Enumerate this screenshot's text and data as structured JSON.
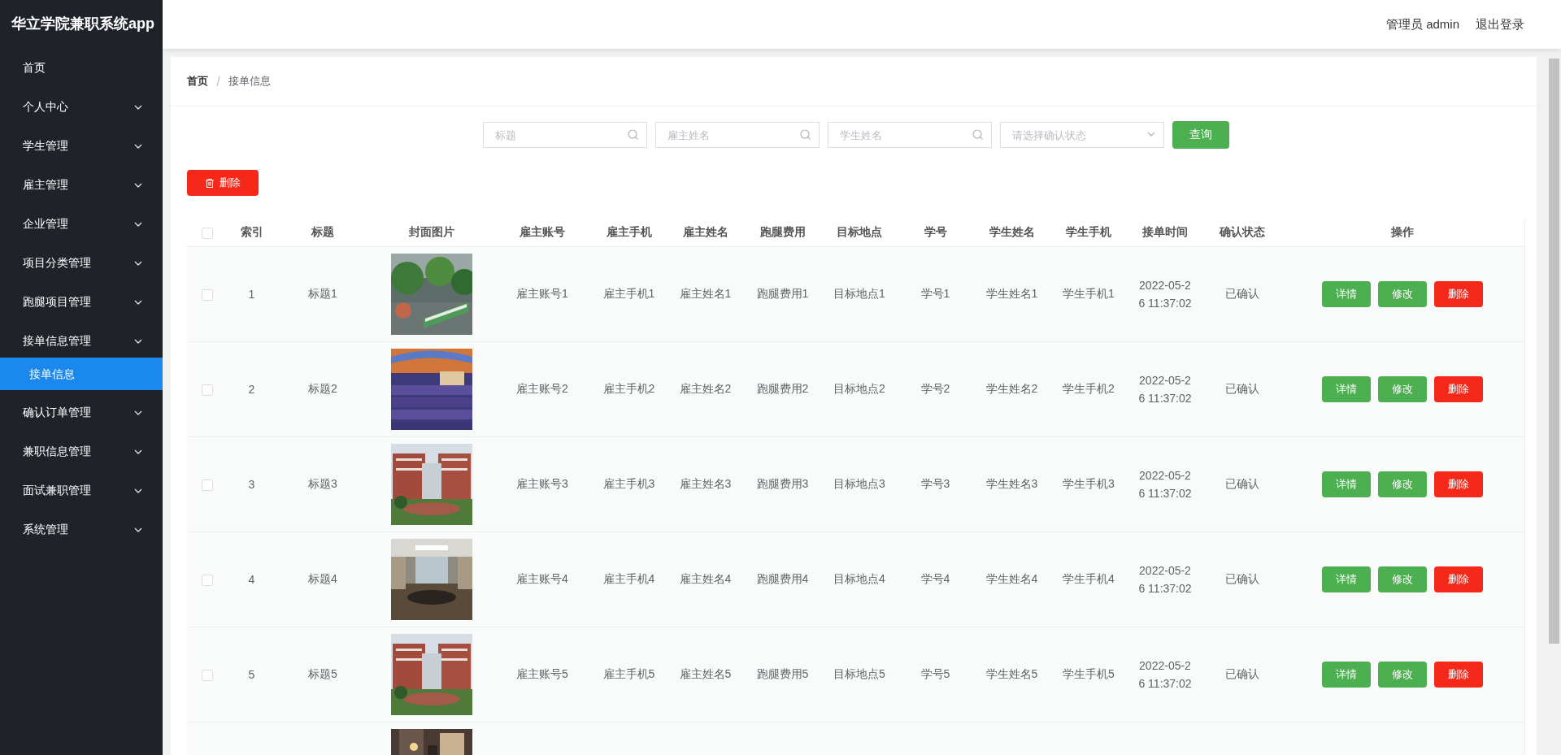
{
  "sidebar": {
    "title": "华立学院兼职系统app",
    "items": [
      {
        "label": "首页",
        "kind": "link"
      },
      {
        "label": "个人中心",
        "kind": "submenu"
      },
      {
        "label": "学生管理",
        "kind": "submenu"
      },
      {
        "label": "雇主管理",
        "kind": "submenu"
      },
      {
        "label": "企业管理",
        "kind": "submenu"
      },
      {
        "label": "项目分类管理",
        "kind": "submenu"
      },
      {
        "label": "跑腿项目管理",
        "kind": "submenu"
      },
      {
        "label": "接单信息管理",
        "kind": "submenu",
        "children": [
          {
            "label": "接单信息",
            "selected": true
          }
        ]
      },
      {
        "label": "确认订单管理",
        "kind": "submenu"
      },
      {
        "label": "兼职信息管理",
        "kind": "submenu"
      },
      {
        "label": "面试兼职管理",
        "kind": "submenu"
      },
      {
        "label": "系统管理",
        "kind": "submenu"
      }
    ]
  },
  "header": {
    "user": "管理员 admin",
    "logout": "退出登录"
  },
  "breadcrumb": [
    "首页",
    "接单信息"
  ],
  "search": {
    "fields": [
      {
        "placeholder": "标题",
        "kind": "text"
      },
      {
        "placeholder": "雇主姓名",
        "kind": "text"
      },
      {
        "placeholder": "学生姓名",
        "kind": "text"
      },
      {
        "placeholder": "请选择确认状态",
        "kind": "select"
      }
    ],
    "button": "查询"
  },
  "toolbar": {
    "delete_button": "删除"
  },
  "table": {
    "select_all": {
      "checked": false
    },
    "columns": [
      "索引",
      "标题",
      "封面图片",
      "雇主账号",
      "雇主手机",
      "雇主姓名",
      "跑腿费用",
      "目标地点",
      "学号",
      "学生姓名",
      "学生手机",
      "接单时间",
      "确认状态",
      "操作"
    ],
    "rows": [
      {
        "checked": false,
        "cells": [
          "1",
          "标题1",
          null,
          "雇主账号1",
          "雇主手机1",
          "雇主姓名1",
          "跑腿费用1",
          "目标地点1",
          "学号1",
          "学生姓名1",
          "学生手机1",
          "2022-05-26 11:37:02",
          "已确认"
        ],
        "actions": [
          {
            "label": "详情",
            "kind": "detail"
          },
          {
            "label": "修改",
            "kind": "edit"
          },
          {
            "label": "删除",
            "kind": "delete"
          }
        ]
      },
      {
        "checked": false,
        "cells": [
          "2",
          "标题2",
          null,
          "雇主账号2",
          "雇主手机2",
          "雇主姓名2",
          "跑腿费用2",
          "目标地点2",
          "学号2",
          "学生姓名2",
          "学生手机2",
          "2022-05-26 11:37:02",
          "已确认"
        ],
        "actions": [
          {
            "label": "详情",
            "kind": "detail"
          },
          {
            "label": "修改",
            "kind": "edit"
          },
          {
            "label": "删除",
            "kind": "delete"
          }
        ]
      },
      {
        "checked": false,
        "cells": [
          "3",
          "标题3",
          null,
          "雇主账号3",
          "雇主手机3",
          "雇主姓名3",
          "跑腿费用3",
          "目标地点3",
          "学号3",
          "学生姓名3",
          "学生手机3",
          "2022-05-26 11:37:02",
          "已确认"
        ],
        "actions": [
          {
            "label": "详情",
            "kind": "detail"
          },
          {
            "label": "修改",
            "kind": "edit"
          },
          {
            "label": "删除",
            "kind": "delete"
          }
        ]
      },
      {
        "checked": false,
        "cells": [
          "4",
          "标题4",
          null,
          "雇主账号4",
          "雇主手机4",
          "雇主姓名4",
          "跑腿费用4",
          "目标地点4",
          "学号4",
          "学生姓名4",
          "学生手机4",
          "2022-05-26 11:37:02",
          "已确认"
        ],
        "actions": [
          {
            "label": "详情",
            "kind": "detail"
          },
          {
            "label": "修改",
            "kind": "edit"
          },
          {
            "label": "删除",
            "kind": "delete"
          }
        ]
      },
      {
        "checked": false,
        "cells": [
          "5",
          "标题5",
          null,
          "雇主账号5",
          "雇主手机5",
          "雇主姓名5",
          "跑腿费用5",
          "目标地点5",
          "学号5",
          "学生姓名5",
          "学生手机5",
          "2022-05-26 11:37:02",
          "已确认"
        ],
        "actions": [
          {
            "label": "详情",
            "kind": "detail"
          },
          {
            "label": "修改",
            "kind": "edit"
          },
          {
            "label": "删除",
            "kind": "delete"
          }
        ]
      },
      {}
    ]
  }
}
